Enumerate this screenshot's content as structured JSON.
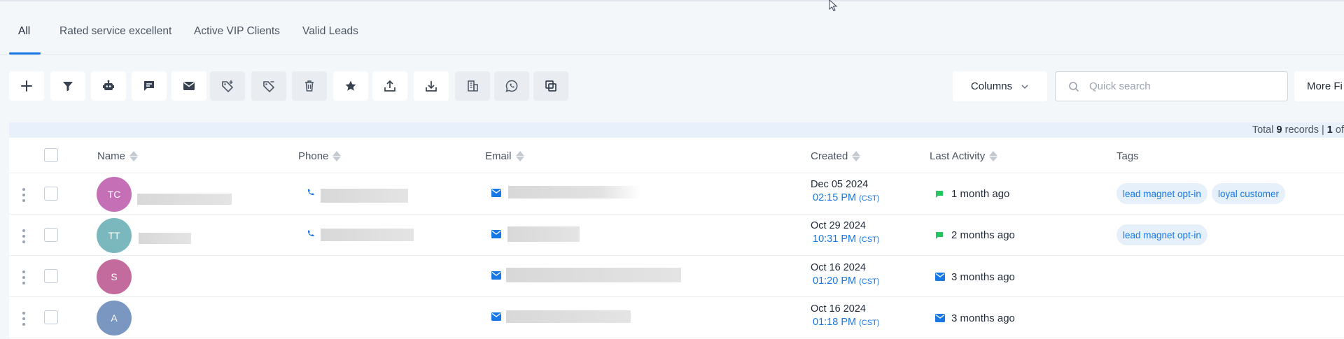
{
  "tabs": [
    {
      "label": "All"
    },
    {
      "label": "Rated service excellent"
    },
    {
      "label": "Active VIP Clients"
    },
    {
      "label": "Valid Leads"
    }
  ],
  "toolbar": {
    "columns_label": "Columns",
    "search_placeholder": "Quick search",
    "more_label": "More Fi"
  },
  "table": {
    "info": {
      "prefix": "Total ",
      "total": "9",
      "middle": " records | ",
      "page": "1",
      "suffix": " of"
    },
    "headers": {
      "name": "Name",
      "phone": "Phone",
      "email": "Email",
      "created": "Created",
      "last_activity": "Last Activity",
      "tags": "Tags"
    },
    "rows": [
      {
        "initials": "TC",
        "avatar_color": "#c46fb6",
        "date": "Dec 05 2024",
        "time": "02:15 PM",
        "tz": "(CST)",
        "activity": "1 month ago",
        "activity_type": "sms",
        "tags": [
          "lead magnet opt-in",
          "loyal customer"
        ]
      },
      {
        "initials": "TT",
        "avatar_color": "#7ab8bd",
        "date": "Oct 29 2024",
        "time": "10:31 PM",
        "tz": "(CST)",
        "activity": "2 months ago",
        "activity_type": "sms",
        "tags": [
          "lead magnet opt-in"
        ]
      },
      {
        "initials": "S",
        "avatar_color": "#c36b9d",
        "date": "Oct 16 2024",
        "time": "01:20 PM",
        "tz": "(CST)",
        "activity": "3 months ago",
        "activity_type": "email",
        "tags": []
      },
      {
        "initials": "A",
        "avatar_color": "#7a97c2",
        "date": "Oct 16 2024",
        "time": "01:18 PM",
        "tz": "(CST)",
        "activity": "3 months ago",
        "activity_type": "email",
        "tags": []
      }
    ]
  },
  "colors": {
    "accent": "#1677e5",
    "sms": "#22c55e"
  }
}
